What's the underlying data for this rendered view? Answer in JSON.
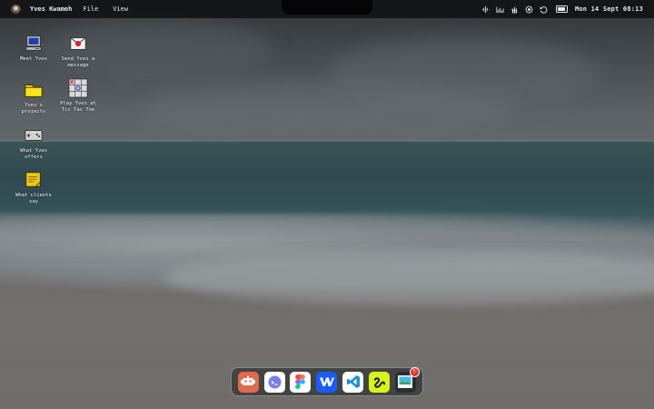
{
  "menubar": {
    "owner": "Yves Kwameh",
    "menus": [
      "File",
      "View"
    ],
    "clock": "Mon 14 Sept 08:13"
  },
  "desktop": {
    "icons": [
      {
        "id": "meet",
        "label": "Meet Yves"
      },
      {
        "id": "message",
        "label": "Send Yves a message"
      },
      {
        "id": "projects",
        "label": "Yves's projects"
      },
      {
        "id": "tictactoe",
        "label": "Play Yves at Tic Tac Toe"
      },
      {
        "id": "offers",
        "label": "What Yves offers"
      },
      {
        "id": "clients",
        "label": "What clients say"
      }
    ]
  },
  "dock": {
    "apps": [
      {
        "name": "robot-app",
        "color": "#e06a4e"
      },
      {
        "name": "chat-app",
        "color": "#ffffff"
      },
      {
        "name": "figma",
        "color": "#ffffff"
      },
      {
        "name": "webflow",
        "color": "#1b5cff"
      },
      {
        "name": "vscode",
        "color": "#ffffff"
      },
      {
        "name": "zap-app",
        "color": "#d7f21e"
      },
      {
        "name": "photos-app",
        "color": "#2b2e30",
        "badge": "5"
      }
    ]
  }
}
